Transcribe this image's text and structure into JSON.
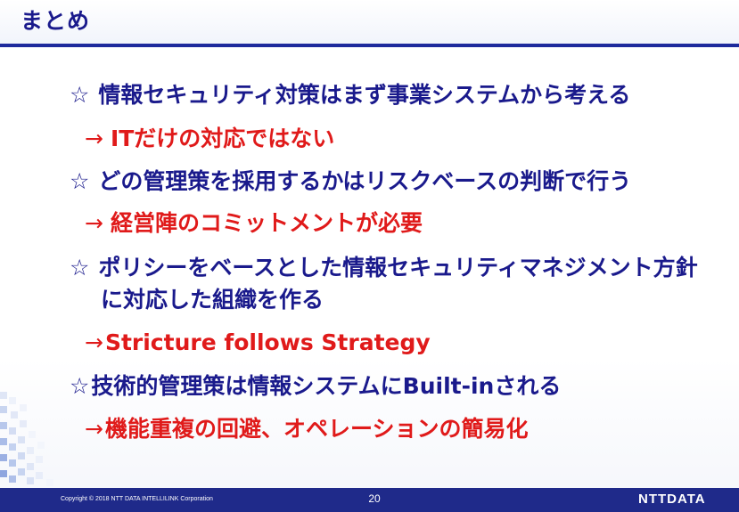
{
  "slide": {
    "title": "まとめ",
    "items": [
      {
        "symbol": "☆",
        "text": "情報セキュリティ対策はまず事業システムから考える"
      },
      {
        "symbol": "→",
        "text": "ITだけの対応ではない"
      },
      {
        "symbol": "☆",
        "text": "どの管理策を採用するかはリスクベースの判断で行う"
      },
      {
        "symbol": "→",
        "text": "経営陣のコミットメントが必要"
      },
      {
        "symbol": "☆",
        "text": "ポリシーをベースとした情報セキュリティマネジメント方針"
      },
      {
        "symbol": "",
        "text": "に対応した組織を作る"
      },
      {
        "symbol": "→",
        "text": "Stricture follows Strategy"
      },
      {
        "symbol": "☆",
        "text": "技術的管理策は情報システムにBuilt-inされる"
      },
      {
        "symbol": "→",
        "text": "機能重複の回避、オペレーションの簡易化"
      }
    ]
  },
  "footer": {
    "copyright": "Copyright © 2018 NTT DATA INTELLILINK Corporation",
    "page_number": "20",
    "logo": "NTTDATA"
  },
  "colors": {
    "title": "#1a1a8c",
    "bullet": "#1a1a8c",
    "sub": "#e01a1a",
    "footer_bg": "#1f2a8a",
    "accent_line": "#1e2a9c"
  },
  "icons": {
    "bullet": "star-outline-icon",
    "sub": "right-arrow-icon"
  }
}
